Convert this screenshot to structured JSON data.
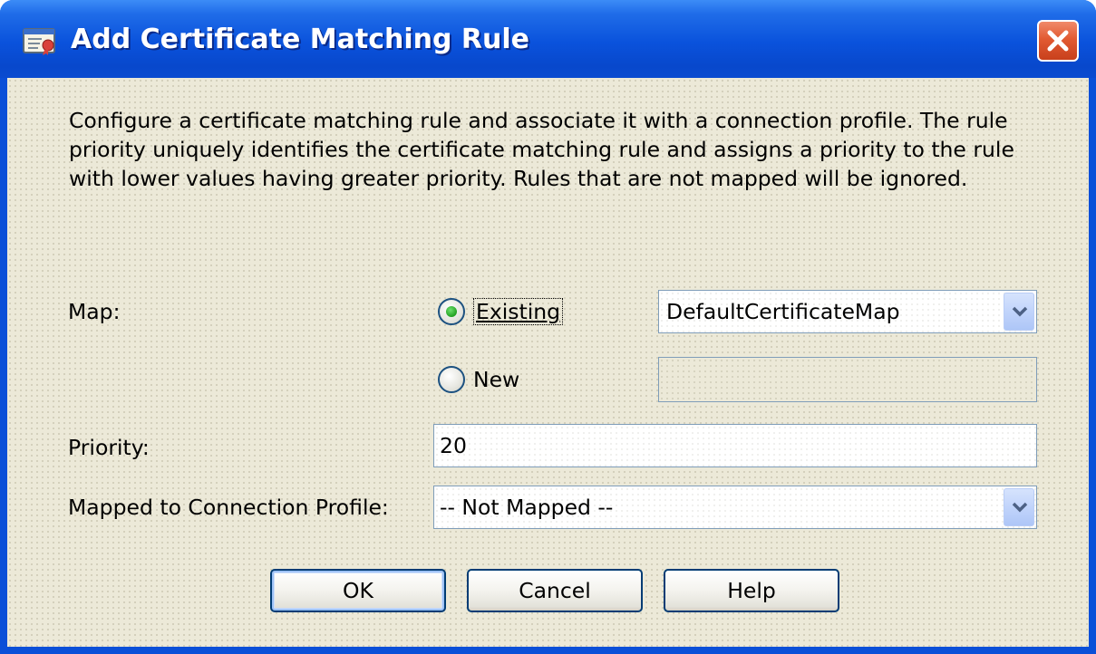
{
  "window": {
    "title": "Add Certificate Matching Rule"
  },
  "description": "Configure a certificate matching rule and associate it with a connection profile. The rule priority uniquely identifies the certificate matching rule and assigns a priority to the rule with lower values having greater priority. Rules that are not mapped will be ignored.",
  "map": {
    "label": "Map:",
    "existing_label": "Existing",
    "existing_selected": true,
    "existing_value": "DefaultCertificateMap",
    "new_label": "New",
    "new_selected": false,
    "new_value": ""
  },
  "priority": {
    "label": "Priority:",
    "value": "20"
  },
  "connection_profile": {
    "label": "Mapped to Connection Profile:",
    "value": "-- Not Mapped --"
  },
  "buttons": {
    "ok": "OK",
    "cancel": "Cancel",
    "help": "Help"
  },
  "colors": {
    "titlebar": "#0a52dc",
    "client": "#ece9d8",
    "close": "#e25a32",
    "radio_selected": "#21a121"
  },
  "icons": {
    "title": "certificate-icon",
    "close": "close-icon",
    "dropdown": "chevron-down-icon"
  }
}
